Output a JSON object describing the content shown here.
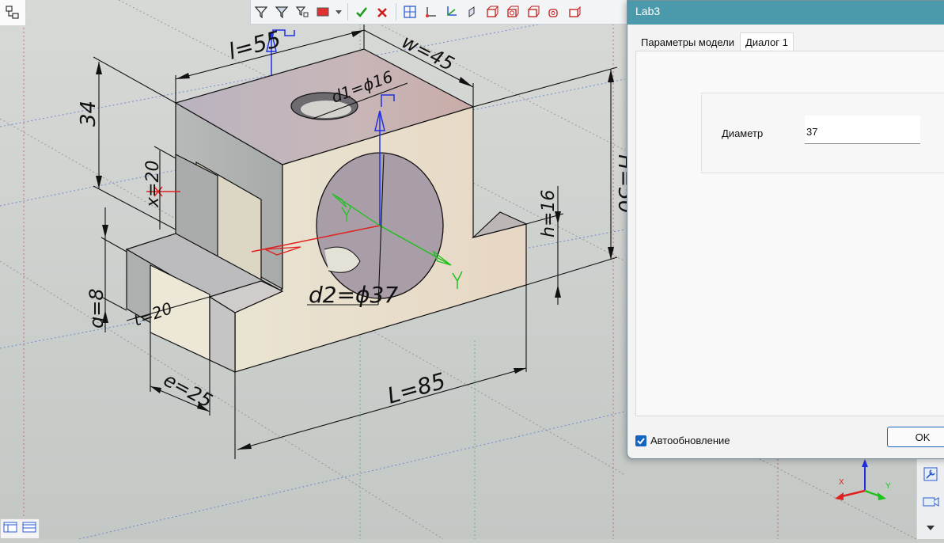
{
  "dialog": {
    "title": "Lab3",
    "tabs": [
      {
        "label": "Параметры модели"
      },
      {
        "label": "Диалог 1"
      }
    ],
    "diameter_label": "Диаметр",
    "diameter_value": "37",
    "autoupdate_label": "Автообновление",
    "autoupdate_checked": true,
    "ok_label": "OK"
  },
  "viewport": {
    "dimensions": {
      "l": "l=55",
      "w": "w=45",
      "d1": "d1=ϕ16",
      "height_34": "34",
      "x": "x=20",
      "H": "H=50",
      "h": "h=16",
      "d2": "d2=ϕ37",
      "q": "q=8",
      "t": "t=20",
      "e": "e=25",
      "L": "L=85"
    },
    "axes": {
      "x": "X",
      "y": "Y",
      "z": "Z"
    },
    "axis_colors": {
      "x": "#e02020",
      "y": "#20c020",
      "z": "#2030e0"
    }
  },
  "toolbar": {
    "icons": [
      "filter-icon",
      "filter-select-icon",
      "filter-tree-icon",
      "color-fill-icon",
      "dropdown-icon",
      "accept-icon",
      "cancel-icon",
      "grid-icon",
      "coordinate-system-icon",
      "axis-icon",
      "plane-icon",
      "box-icon",
      "box-hole-icon",
      "box-cut-icon",
      "box-round-icon",
      "box-side-icon"
    ]
  }
}
